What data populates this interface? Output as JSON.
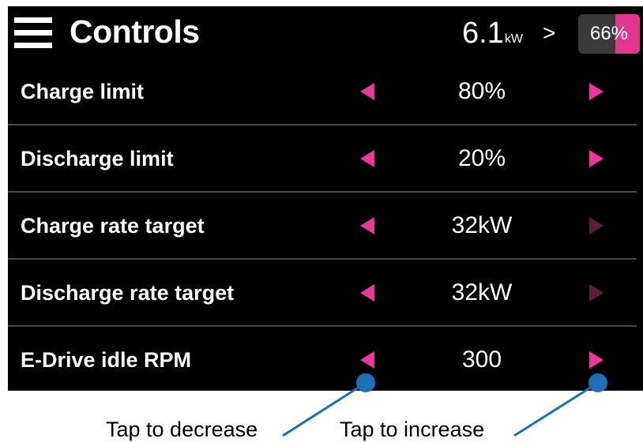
{
  "header": {
    "title": "Controls",
    "power_value": "6.1",
    "power_unit": "kW",
    "chevron": ">",
    "battery_percent": "66%",
    "battery_level": 0.66
  },
  "controls": [
    {
      "label": "Charge limit",
      "value": "80%",
      "decrease_enabled": true,
      "increase_enabled": true
    },
    {
      "label": "Discharge limit",
      "value": "20%",
      "decrease_enabled": true,
      "increase_enabled": true
    },
    {
      "label": "Charge rate target",
      "value": "32kW",
      "decrease_enabled": true,
      "increase_enabled": false
    },
    {
      "label": "Discharge rate target",
      "value": "32kW",
      "decrease_enabled": true,
      "increase_enabled": false
    },
    {
      "label": "E-Drive idle RPM",
      "value": "300",
      "decrease_enabled": true,
      "increase_enabled": true
    }
  ],
  "annotations": {
    "decrease": "Tap to decrease",
    "increase": "Tap to increase"
  },
  "colors": {
    "accent": "#e8399a",
    "accent_disabled": "#5a1f3f",
    "callout": "#1f6fb6",
    "background": "#000000"
  }
}
